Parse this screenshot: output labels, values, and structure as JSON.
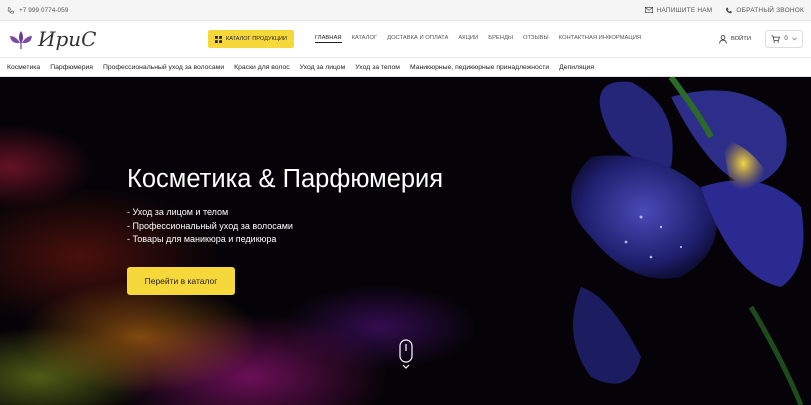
{
  "topbar": {
    "phone": "+7 999 0774-059",
    "write_us": "НАПИШИТЕ НАМ",
    "callback": "ОБРАТНЫЙ ЗВОНОК"
  },
  "header": {
    "logo_text": "ИриС",
    "catalog_button": "КАТАЛОГ ПРОДУКЦИИ",
    "nav": [
      "ГЛАВНАЯ",
      "КАТАЛОГ",
      "ДОСТАВКА И ОПЛАТА",
      "АКЦИИ",
      "БРЕНДЫ",
      "ОТЗЫВЫ",
      "КОНТАКТНАЯ ИНФОРМАЦИЯ"
    ],
    "login": "ВОЙТИ",
    "cart_count": "0"
  },
  "categories": [
    "Косметика",
    "Парфюмерия",
    "Профессиональный уход за волосами",
    "Краски для волос",
    "Уход за лицом",
    "Уход за телом",
    "Маникюрные, педикюрные принадлежности",
    "Депиляция"
  ],
  "hero": {
    "title": "Косметика & Парфюмерия",
    "list": [
      "- Уход за лицом и телом",
      "- Профессиональный уход за волосами",
      "- Товары для маникюра и педикюра"
    ],
    "button": "Перейти в каталог"
  },
  "colors": {
    "accent": "#f7d83b"
  }
}
